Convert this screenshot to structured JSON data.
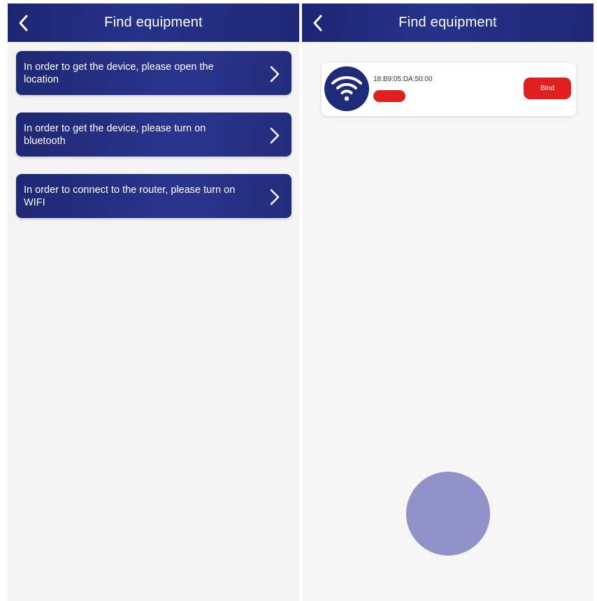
{
  "left_screen": {
    "header": {
      "title": "Find equipment",
      "back_icon": "chevron-left-icon"
    },
    "permission_cards": [
      {
        "text": "In order to get the device, please open the location",
        "icon": "chevron-right-icon"
      },
      {
        "text": "In order to get the device, please turn on bluetooth",
        "icon": "chevron-right-icon"
      },
      {
        "text": "In order to connect to the router, please turn on WIFI",
        "icon": "chevron-right-icon"
      }
    ]
  },
  "right_screen": {
    "header": {
      "title": "Find equipment",
      "back_icon": "chevron-left-icon"
    },
    "device": {
      "icon": "wifi-icon",
      "mac": "18:B9:05:DA:50:00",
      "bind_label": "Bind"
    },
    "scan_button_icon": "scan-circle"
  },
  "colors": {
    "primary": "#1f2a78",
    "accent": "#e11f1f",
    "scan_button": "#9192c8",
    "background": "#f4f4f4"
  }
}
